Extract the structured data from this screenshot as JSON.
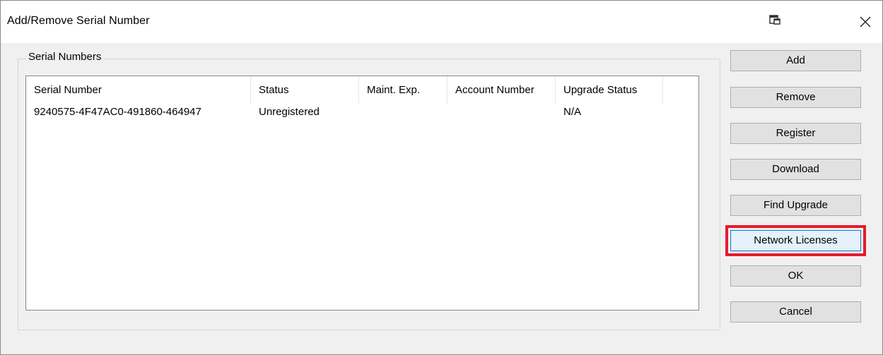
{
  "window": {
    "title": "Add/Remove Serial Number"
  },
  "titlebar_icons": [
    "restore-icon",
    "close-icon"
  ],
  "group": {
    "label": "Serial Numbers"
  },
  "table": {
    "columns": [
      "Serial Number",
      "Status",
      "Maint. Exp.",
      "Account Number",
      "Upgrade Status"
    ],
    "rows": [
      {
        "serial_number": "9240575-4F47AC0-491860-464947",
        "status": "Unregistered",
        "maint_exp": "",
        "account_number": "",
        "upgrade_status": "N/A"
      }
    ]
  },
  "buttons": {
    "add": "Add",
    "remove": "Remove",
    "register": "Register",
    "download": "Download",
    "find_upgrade": "Find Upgrade",
    "network_licenses": "Network Licenses",
    "ok": "OK",
    "cancel": "Cancel"
  },
  "colors": {
    "highlight_outline": "#e8192c",
    "focused_button_bg": "#e5f1fb",
    "dialog_bg": "#f0f0f0"
  }
}
